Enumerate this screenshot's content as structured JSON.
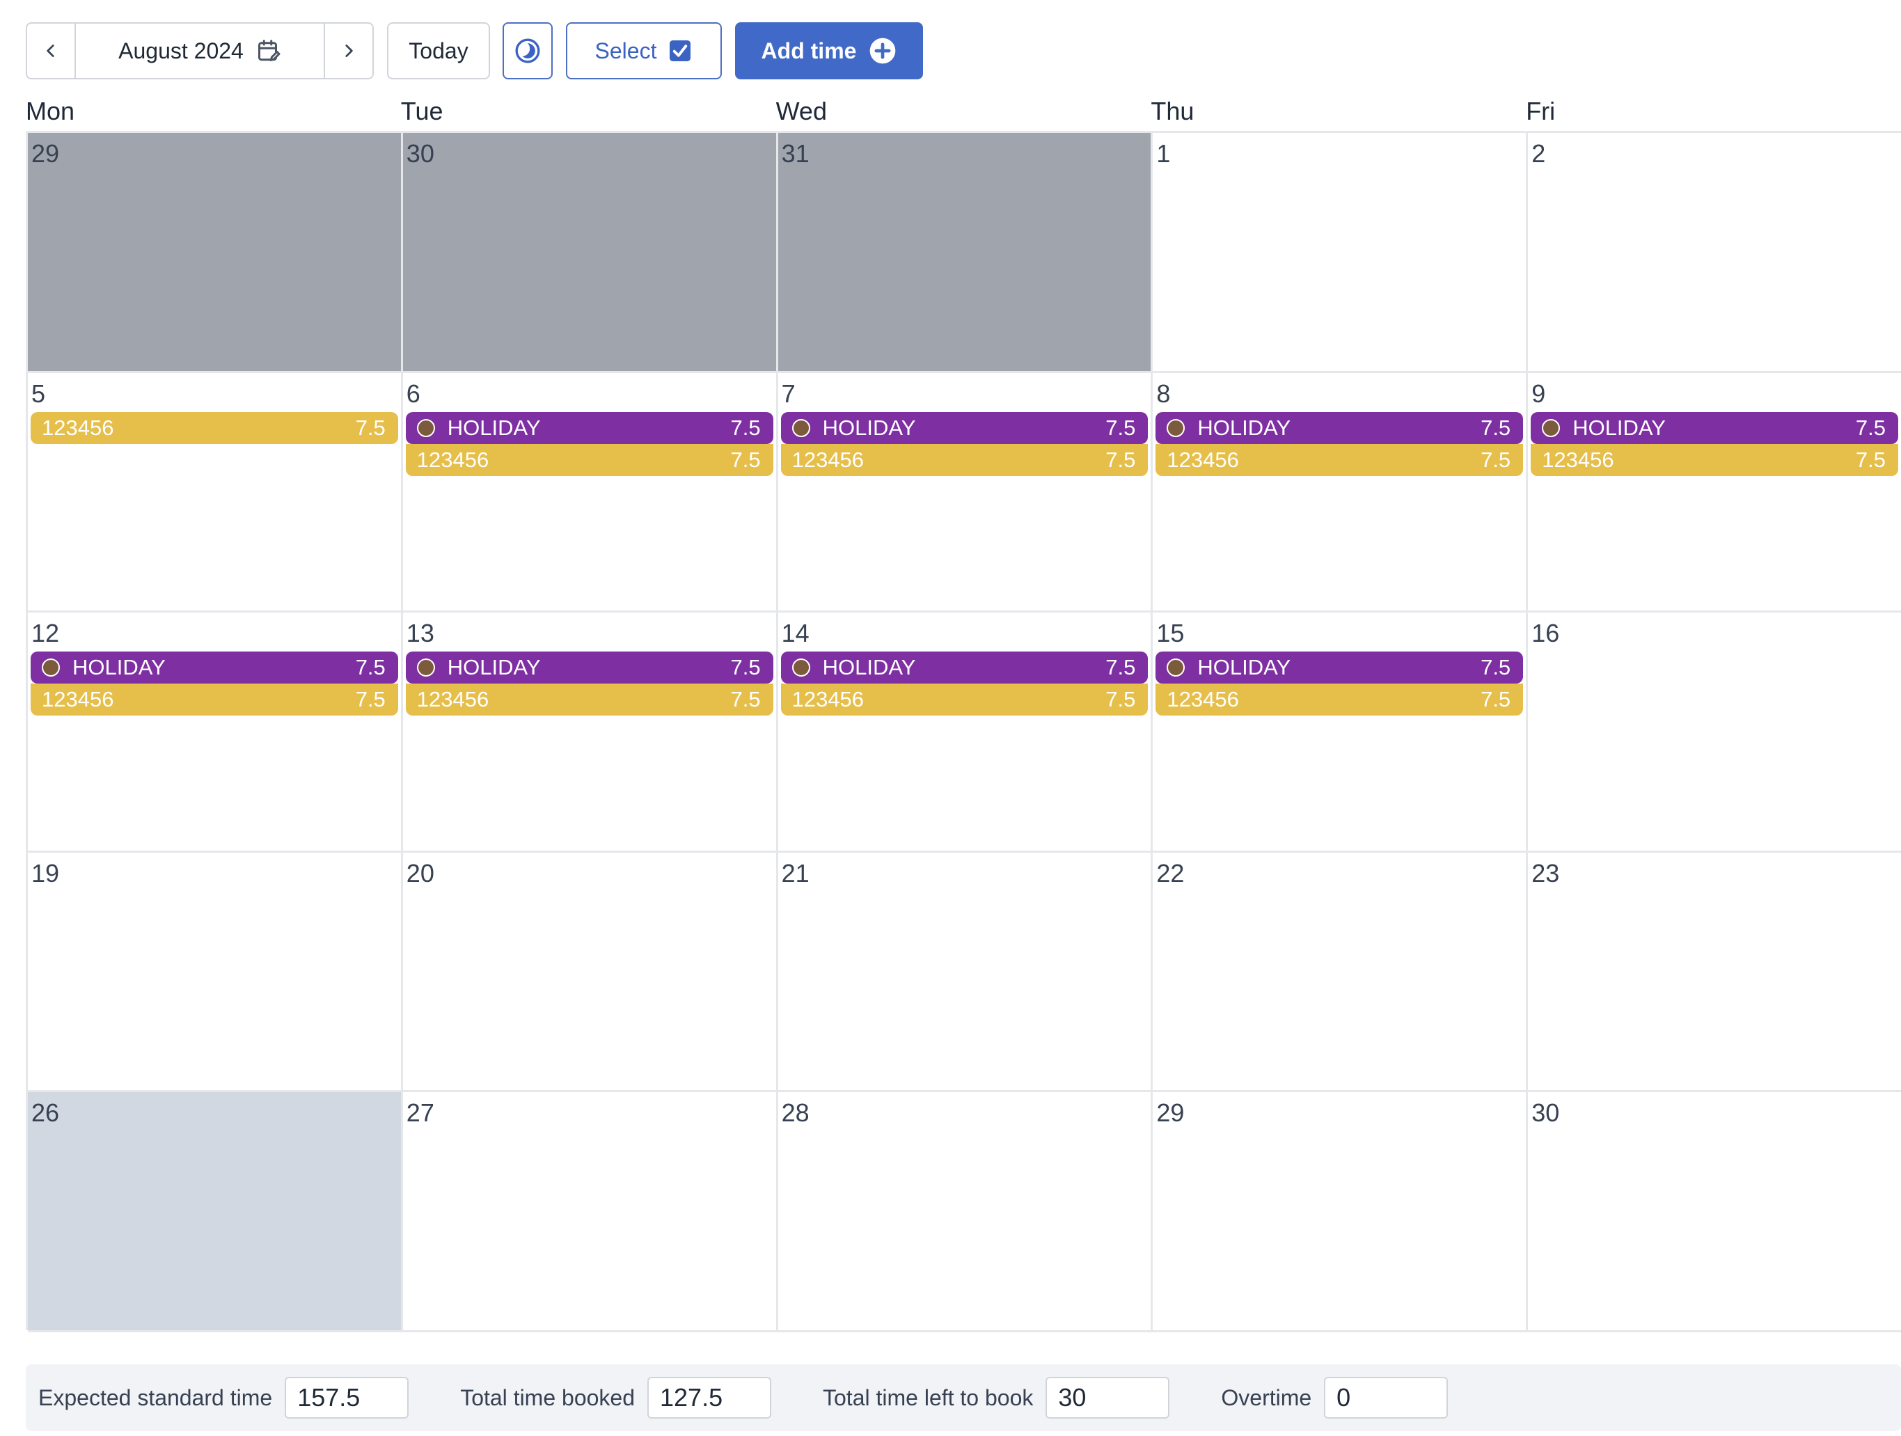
{
  "toolbar": {
    "month_label": "August 2024",
    "today_label": "Today",
    "select_label": "Select",
    "add_time_label": "Add time",
    "icons": {
      "prev": "chevron-left-icon",
      "next": "chevron-right-icon",
      "calendar": "calendar-edit-icon",
      "theme": "half-moon-icon",
      "select": "checkbox-checked-icon",
      "add": "plus-circle-icon"
    }
  },
  "weekdays": [
    "Mon",
    "Tue",
    "Wed",
    "Thu",
    "Fri"
  ],
  "colors": {
    "holiday": "#7e2fa2",
    "project": "#e6be4a",
    "outside_month": "#a0a5ad",
    "today": "#d1d8e2",
    "primary": "#4169c7"
  },
  "weeks": [
    [
      {
        "day": "29",
        "state": "outside",
        "entries": []
      },
      {
        "day": "30",
        "state": "outside",
        "entries": []
      },
      {
        "day": "31",
        "state": "outside",
        "entries": []
      },
      {
        "day": "1",
        "state": "normal",
        "entries": []
      },
      {
        "day": "2",
        "state": "normal",
        "entries": []
      }
    ],
    [
      {
        "day": "5",
        "state": "normal",
        "entries": [
          {
            "type": "project",
            "name": "123456",
            "hours": "7.5"
          }
        ]
      },
      {
        "day": "6",
        "state": "normal",
        "entries": [
          {
            "type": "holiday",
            "name": "HOLIDAY",
            "hours": "7.5"
          },
          {
            "type": "project",
            "name": "123456",
            "hours": "7.5"
          }
        ]
      },
      {
        "day": "7",
        "state": "normal",
        "entries": [
          {
            "type": "holiday",
            "name": "HOLIDAY",
            "hours": "7.5"
          },
          {
            "type": "project",
            "name": "123456",
            "hours": "7.5"
          }
        ]
      },
      {
        "day": "8",
        "state": "normal",
        "entries": [
          {
            "type": "holiday",
            "name": "HOLIDAY",
            "hours": "7.5"
          },
          {
            "type": "project",
            "name": "123456",
            "hours": "7.5"
          }
        ]
      },
      {
        "day": "9",
        "state": "normal",
        "entries": [
          {
            "type": "holiday",
            "name": "HOLIDAY",
            "hours": "7.5"
          },
          {
            "type": "project",
            "name": "123456",
            "hours": "7.5"
          }
        ]
      }
    ],
    [
      {
        "day": "12",
        "state": "normal",
        "entries": [
          {
            "type": "holiday",
            "name": "HOLIDAY",
            "hours": "7.5"
          },
          {
            "type": "project",
            "name": "123456",
            "hours": "7.5"
          }
        ]
      },
      {
        "day": "13",
        "state": "normal",
        "entries": [
          {
            "type": "holiday",
            "name": "HOLIDAY",
            "hours": "7.5"
          },
          {
            "type": "project",
            "name": "123456",
            "hours": "7.5"
          }
        ]
      },
      {
        "day": "14",
        "state": "normal",
        "entries": [
          {
            "type": "holiday",
            "name": "HOLIDAY",
            "hours": "7.5"
          },
          {
            "type": "project",
            "name": "123456",
            "hours": "7.5"
          }
        ]
      },
      {
        "day": "15",
        "state": "normal",
        "entries": [
          {
            "type": "holiday",
            "name": "HOLIDAY",
            "hours": "7.5"
          },
          {
            "type": "project",
            "name": "123456",
            "hours": "7.5"
          }
        ]
      },
      {
        "day": "16",
        "state": "normal",
        "entries": []
      }
    ],
    [
      {
        "day": "19",
        "state": "normal",
        "entries": []
      },
      {
        "day": "20",
        "state": "normal",
        "entries": []
      },
      {
        "day": "21",
        "state": "normal",
        "entries": []
      },
      {
        "day": "22",
        "state": "normal",
        "entries": []
      },
      {
        "day": "23",
        "state": "normal",
        "entries": []
      }
    ],
    [
      {
        "day": "26",
        "state": "today",
        "entries": []
      },
      {
        "day": "27",
        "state": "normal",
        "entries": []
      },
      {
        "day": "28",
        "state": "normal",
        "entries": []
      },
      {
        "day": "29",
        "state": "normal",
        "entries": []
      },
      {
        "day": "30",
        "state": "normal",
        "entries": []
      }
    ]
  ],
  "summary": {
    "expected_label": "Expected standard time",
    "expected_value": "157.5",
    "booked_label": "Total time booked",
    "booked_value": "127.5",
    "left_label": "Total time left to book",
    "left_value": "30",
    "overtime_label": "Overtime",
    "overtime_value": "0"
  }
}
